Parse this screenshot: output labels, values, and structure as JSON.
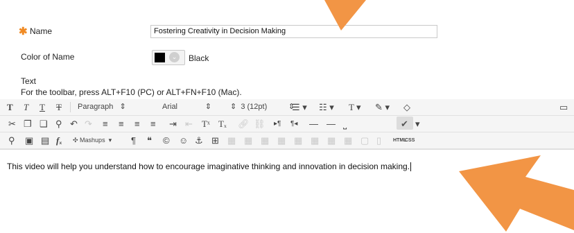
{
  "form": {
    "name_label": "Name",
    "required_marker": "✱",
    "name_value": "Fostering Creativity in Decision Making",
    "color_label": "Color of Name",
    "color_value_text": "Black",
    "color_swatch": "#000000",
    "text_label": "Text",
    "toolbar_hint": "For the toolbar, press ALT+F10 (PC) or ALT+FN+F10 (Mac)."
  },
  "toolbar": {
    "row1": {
      "paragraph": "Paragraph",
      "font": "Arial",
      "size": "3 (12pt)"
    },
    "row3": {
      "mashups": "Mashups",
      "html": "HTML",
      "css": "CSS"
    }
  },
  "editor": {
    "content": "This video will help you understand how to encourage imaginative thinking and innovation in decision making."
  },
  "colors": {
    "required": "#f08a24",
    "arrow": "#f29545",
    "toolbar_bg": "#f5f5f5"
  }
}
